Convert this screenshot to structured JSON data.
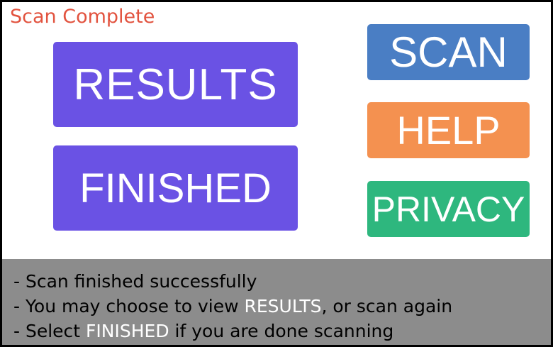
{
  "status": {
    "title": "Scan Complete"
  },
  "buttons": {
    "results": "RESULTS",
    "finished": "FINISHED",
    "scan": "SCAN",
    "help": "HELP",
    "privacy": "PRIVACY"
  },
  "info": {
    "line1": "- Scan finished successfully",
    "line2_prefix": "- You may choose to view ",
    "line2_highlight": "RESULTS",
    "line2_suffix": ", or scan again",
    "line3_prefix": "- Select ",
    "line3_highlight": "FINISHED",
    "line3_suffix": " if you are done scanning"
  },
  "colors": {
    "status_title": "#e2533f",
    "results_button": "#6a52e4",
    "finished_button": "#6a52e4",
    "scan_button": "#4a7ec4",
    "help_button": "#f49150",
    "privacy_button": "#2eb77e",
    "info_panel": "#8c8c8c",
    "highlight_text": "#ffffff"
  }
}
